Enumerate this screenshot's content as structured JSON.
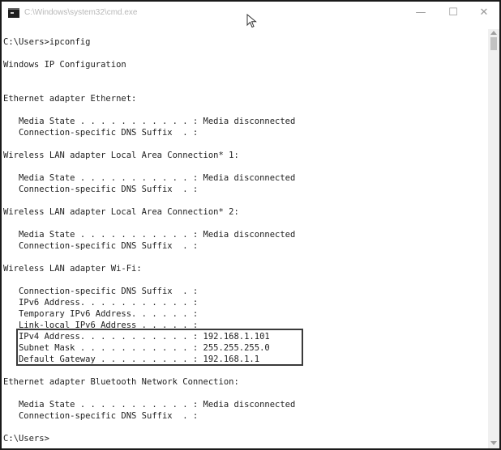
{
  "window": {
    "title": "C:\\Windows\\system32\\cmd.exe",
    "minimize_glyph": "—",
    "maximize_glyph": "☐",
    "close_glyph": "✕"
  },
  "icons": {
    "app": "cmd-icon",
    "cursor": "mouse-pointer-icon"
  },
  "console": {
    "lines": [
      "C:\\Users>ipconfig",
      "",
      "Windows IP Configuration",
      "",
      "",
      "Ethernet adapter Ethernet:",
      "",
      "   Media State . . . . . . . . . . . : Media disconnected",
      "   Connection-specific DNS Suffix  . :",
      "",
      "Wireless LAN adapter Local Area Connection* 1:",
      "",
      "   Media State . . . . . . . . . . . : Media disconnected",
      "   Connection-specific DNS Suffix  . :",
      "",
      "Wireless LAN adapter Local Area Connection* 2:",
      "",
      "   Media State . . . . . . . . . . . : Media disconnected",
      "   Connection-specific DNS Suffix  . :",
      "",
      "Wireless LAN adapter Wi-Fi:",
      "",
      "   Connection-specific DNS Suffix  . :",
      "   IPv6 Address. . . . . . . . . . . :",
      "   Temporary IPv6 Address. . . . . . :",
      "   Link-local IPv6 Address . . . . . :",
      "   IPv4 Address. . . . . . . . . . . : 192.168.1.101",
      "   Subnet Mask . . . . . . . . . . . : 255.255.255.0",
      "   Default Gateway . . . . . . . . . : 192.168.1.1",
      "",
      "Ethernet adapter Bluetooth Network Connection:",
      "",
      "   Media State . . . . . . . . . . . : Media disconnected",
      "   Connection-specific DNS Suffix  . :",
      "",
      "C:\\Users>"
    ]
  },
  "highlight": {
    "label": "ipv4-subnet-gateway-highlight",
    "color": "#3a3a3a"
  },
  "colors": {
    "text": "#1e1e1e",
    "background": "#ffffff",
    "title_text": "#b8b8b8"
  }
}
